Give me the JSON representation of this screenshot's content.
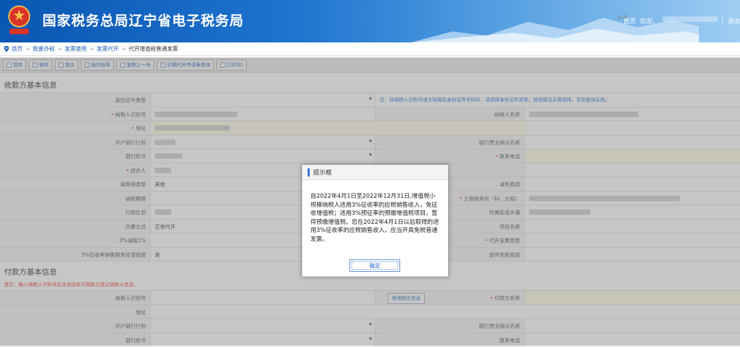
{
  "header": {
    "title": "国家税务总局辽宁省电子税务局",
    "links": {
      "home": "首页",
      "welcome": "欢迎，",
      "sep": "|",
      "logout": "退出"
    }
  },
  "breadcrumb": [
    "首页",
    "我要办税",
    "发票使用",
    "发票代开",
    "代开增值税普通发票"
  ],
  "toolbar": {
    "buttons": [
      "暂存",
      "保存",
      "提交",
      "操作指导",
      "复制上一份",
      "近期代开申请表查询",
      "打印(E)"
    ]
  },
  "receiver_section": {
    "title": "收款方基本信息",
    "rows": [
      {
        "l1": "身份证件类型",
        "v1": "",
        "l2": "",
        "v2": "注：非纳税人识别号或大陆居民身份证件号码时，请选择身份证件类型，其他情况无需选择，否则查询无效。"
      },
      {
        "l1": "纳税人识别号",
        "v1": "",
        "l2": "纳税人名称",
        "v2": ""
      },
      {
        "l1": "地址",
        "v1": "",
        "l2": "",
        "v2": ""
      },
      {
        "l1": "开户银行行别",
        "v1": "",
        "l2": "银行营业网点名称",
        "v2": ""
      },
      {
        "l1": "银行账号",
        "v1": "",
        "l2": "联系电话",
        "v2": ""
      },
      {
        "l1": "经办人",
        "v1": "",
        "l2": "",
        "v2": ""
      },
      {
        "l1": "减免税类型",
        "v1": "其他",
        "l2": "减免原因",
        "v2": ""
      },
      {
        "l1": "纳税期限",
        "v1": "",
        "l2": "主管税务所（科、分局）",
        "v2": ""
      },
      {
        "l1": "行政区划",
        "v1": "",
        "l2": "所属街道乡镇",
        "v2": ""
      },
      {
        "l1": "开票方式",
        "v1": "正常代开",
        "l2": "项目名称",
        "v2": ""
      },
      {
        "l1": "3%减按1%",
        "v1": "",
        "l2": "代开发票类型",
        "v2": ""
      },
      {
        "l1": "3%征收率销售额免征增值税",
        "v1": "是",
        "l2": "放弃免税原因",
        "v2": ""
      }
    ]
  },
  "payer_section": {
    "title": "付款方基本信息",
    "hint": "提示：输入纳税人识别号后点击回车可获取已登记纳税人信息。",
    "query_button": "常用购方信息",
    "rows": [
      {
        "l1": "纳税人识别号",
        "v1": "",
        "l2": "付款方名称",
        "v2": ""
      },
      {
        "l1": "地址",
        "v1": "",
        "l2": "",
        "v2": ""
      },
      {
        "l1": "开户银行行别",
        "v1": "",
        "l2": "银行营业网点名称",
        "v2": ""
      },
      {
        "l1": "银行账号",
        "v1": "",
        "l2": "联系电话",
        "v2": ""
      }
    ]
  },
  "dialog": {
    "title": "提示框",
    "message": "自2022年4月1日至2022年12月31日,增值税小规模纳税人适用3%征收率的应税销售收入，免征收增值税；适用3%预征率的预缴增值税项目，暂停预缴增值税。您在2022年4月1日以后取得的适用3%征收率的应税销售收入，应当开具免税普通发票。",
    "ok_label": "确定"
  },
  "colors": {
    "header_blue": "#0a56b3",
    "link_blue": "#1c5fb5",
    "required_red": "#ee3333"
  }
}
